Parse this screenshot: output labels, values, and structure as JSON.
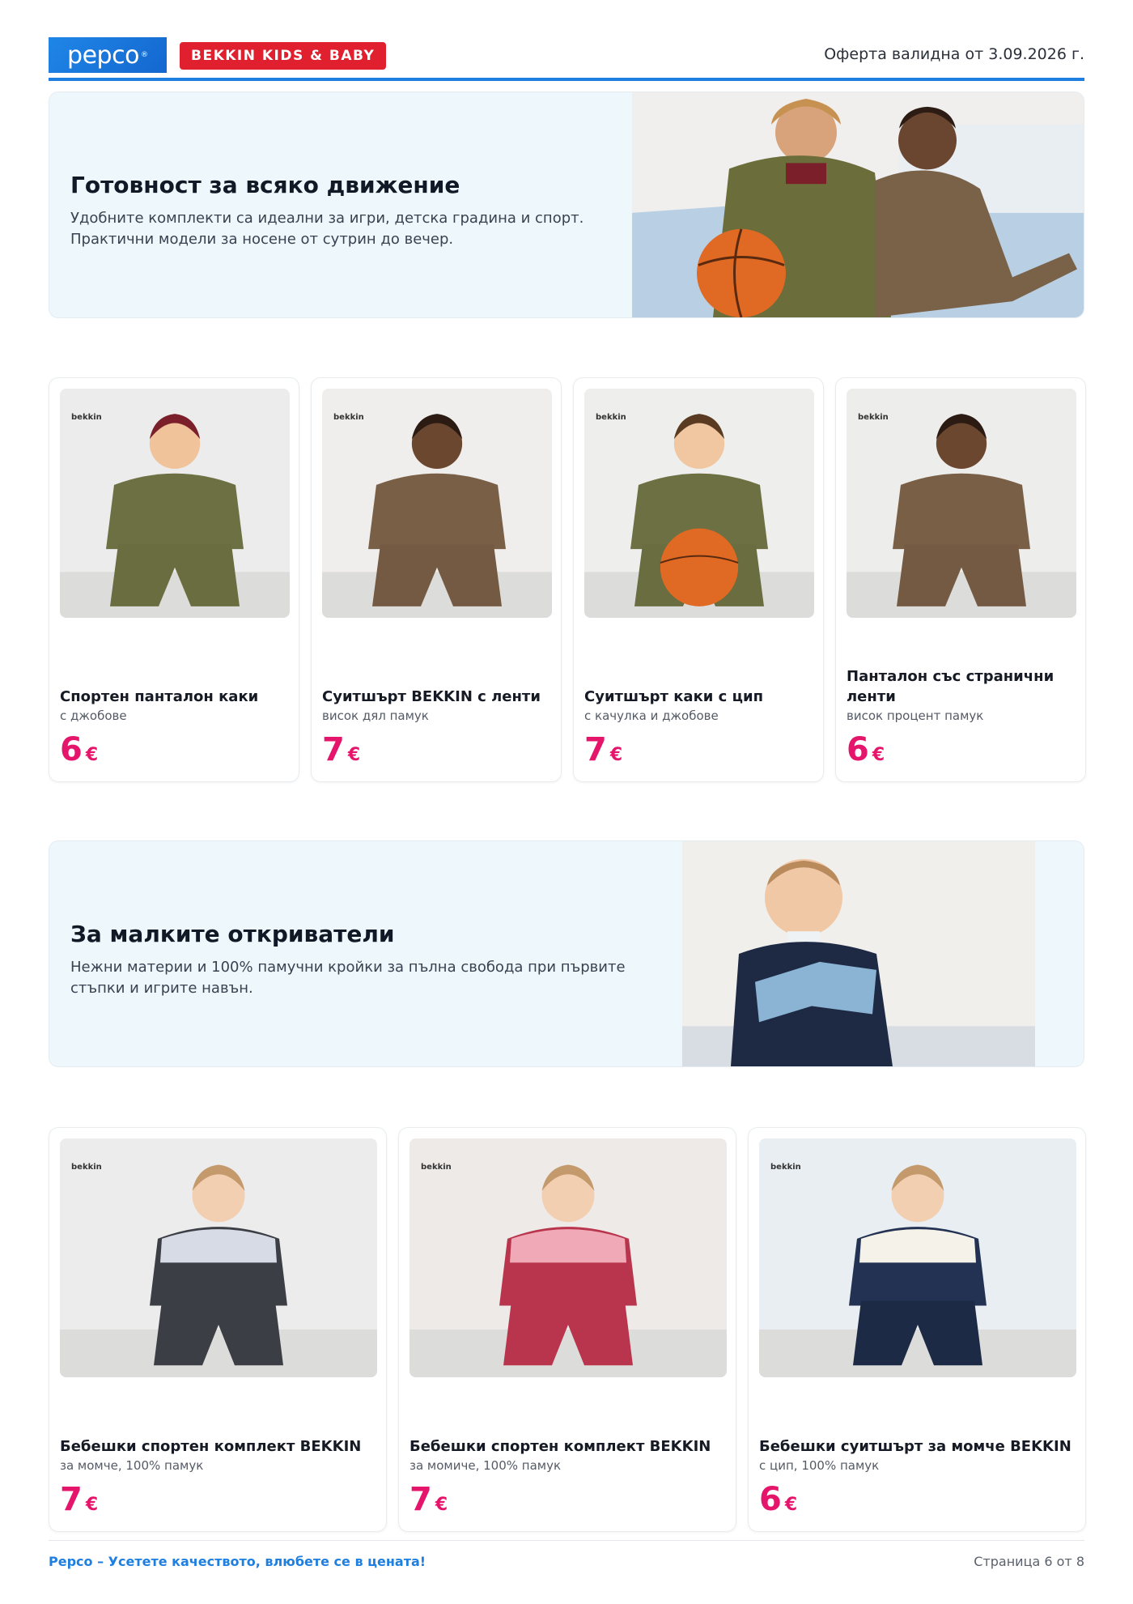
{
  "header": {
    "logo_text": "pepco",
    "logo_mark": "®",
    "badge": "BEKKIN KIDS & BABY",
    "validity": "Оферта валидна от 3.09.2026 г."
  },
  "banner1": {
    "title": "Готовност за всяко движение",
    "text": "Удобните комплекти са идеални за игри, детска градина и спорт. Практични модели за носене от сутрин до вечер."
  },
  "row1": [
    {
      "brand": "bekkin",
      "title": "Спортен панталон каки",
      "subtitle": "с джобове",
      "price": "6",
      "currency": "€"
    },
    {
      "brand": "bekkin",
      "title": "Суитшърт BEKKIN с ленти",
      "subtitle": "висок дял памук",
      "price": "7",
      "currency": "€"
    },
    {
      "brand": "bekkin",
      "title": "Суитшърт каки с цип",
      "subtitle": "с качулка и джобове",
      "price": "7",
      "currency": "€"
    },
    {
      "brand": "bekkin",
      "title": "Панталон със странични ленти",
      "subtitle": "висок процент памук",
      "price": "6",
      "currency": "€"
    }
  ],
  "banner2": {
    "title": "За малките откриватели",
    "text": "Нежни материи и 100% памучни кройки за пълна свобода при първите стъпки и игрите навън."
  },
  "row2": [
    {
      "brand": "bekkin",
      "title": "Бебешки спортен комплект BEKKIN",
      "subtitle": "за момче, 100% памук",
      "price": "7",
      "currency": "€"
    },
    {
      "brand": "bekkin",
      "title": "Бебешки спортен комплект BEKKIN",
      "subtitle": "за момиче, 100% памук",
      "price": "7",
      "currency": "€"
    },
    {
      "brand": "bekkin",
      "title": "Бебешки суитшърт за момче BEKKIN",
      "subtitle": "с цип, 100% памук",
      "price": "6",
      "currency": "€"
    }
  ],
  "footer": {
    "slogan": "Pepco – Усетете качеството, влюбете се в цената!",
    "page": "Страница 6 от 8"
  },
  "colors": {
    "brand_blue": "#1e7fe0",
    "badge_red": "#e0202e",
    "price_pink": "#e4156b",
    "banner_bg": "#eef7fc"
  }
}
